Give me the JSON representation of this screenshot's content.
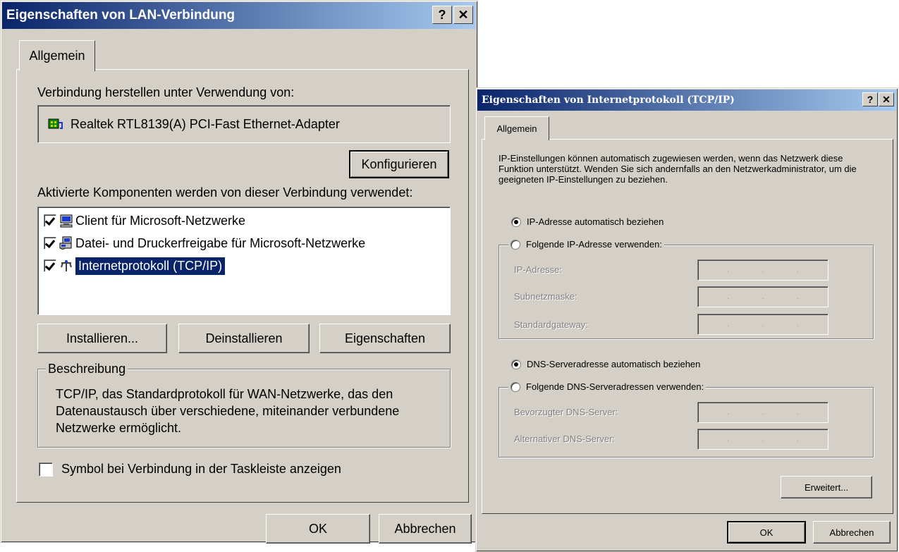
{
  "dialog1": {
    "title": "Eigenschaften von LAN-Verbindung",
    "help_button": "?",
    "close_button": "✕",
    "tab": "Allgemein",
    "connect_using_label": "Verbindung herstellen unter Verwendung von:",
    "adapter_name": "Realtek RTL8139(A) PCI-Fast Ethernet-Adapter",
    "configure_button": "Konfigurieren",
    "components_label": "Aktivierte Komponenten werden von dieser Verbindung verwendet:",
    "components": [
      {
        "label": "Client für Microsoft-Netzwerke",
        "checked": true,
        "icon": "network-client-icon"
      },
      {
        "label": "Datei- und Druckerfreigabe für Microsoft-Netzwerke",
        "checked": true,
        "icon": "printer-share-icon"
      },
      {
        "label": "Internetprotokoll (TCP/IP)",
        "checked": true,
        "icon": "protocol-icon",
        "selected": true
      }
    ],
    "install_button": "Installieren...",
    "uninstall_button": "Deinstallieren",
    "properties_button": "Eigenschaften",
    "description_legend": "Beschreibung",
    "description_text": "TCP/IP, das Standardprotokoll für WAN-Netzwerke, das den Datenaustausch über verschiedene, miteinander verbundene Netzwerke ermöglicht.",
    "taskbar_checkbox_label": "Symbol bei Verbindung in der Taskleiste anzeigen",
    "ok_button": "OK",
    "cancel_button": "Abbrechen"
  },
  "dialog2": {
    "title": "Eigenschaften von Internetprotokoll (TCP/IP)",
    "help_button": "?",
    "close_button": "✕",
    "tab": "Allgemein",
    "intro_text": "IP-Einstellungen können automatisch zugewiesen werden, wenn das Netzwerk diese Funktion unterstützt. Wenden Sie sich andernfalls an den Netzwerkadministrator, um die geeigneten IP-Einstellungen zu beziehen.",
    "ip_auto_label": "IP-Adresse automatisch beziehen",
    "ip_manual_label": "Folgende IP-Adresse verwenden:",
    "ip_address_label": "IP-Adresse:",
    "subnet_label": "Subnetzmaske:",
    "gateway_label": "Standardgateway:",
    "dns_auto_label": "DNS-Serveradresse automatisch beziehen",
    "dns_manual_label": "Folgende DNS-Serveradressen verwenden:",
    "preferred_dns_label": "Bevorzugter DNS-Server:",
    "alternate_dns_label": "Alternativer DNS-Server:",
    "advanced_button": "Erweitert...",
    "ok_button": "OK",
    "cancel_button": "Abbrechen"
  },
  "colors": {
    "title_active_start": "#0a246a",
    "title_active_end": "#a6caf0",
    "face": "#d4d0c8",
    "selection": "#0a246a"
  }
}
